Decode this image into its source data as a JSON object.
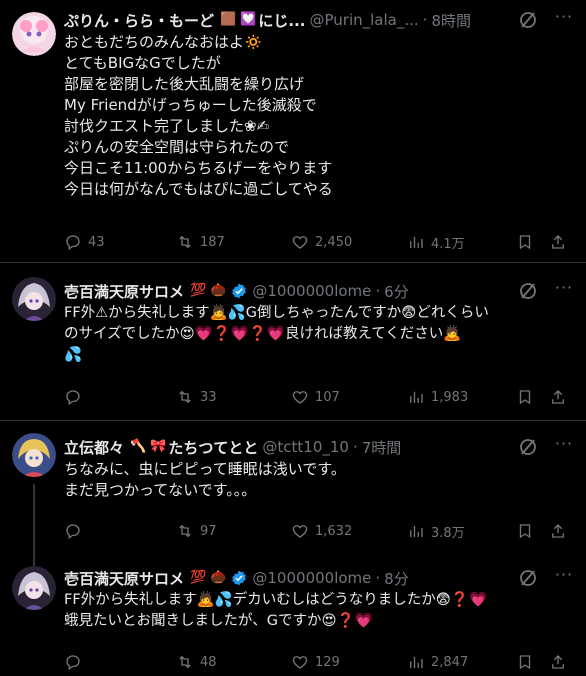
{
  "tweets": [
    {
      "name": "ぷりん・らら・もーど",
      "name_emoji": [
        "🟫",
        "💟"
      ],
      "name_suffix": "にじ...",
      "handle": "@Purin_lala_...",
      "time": "8時間",
      "lines": [
        "おともだちのみんなおはよ🔅",
        "とてもBIGなGでしたが",
        "部屋を密閉した後大乱闘を繰り広げ",
        "My Friendがげっちゅーした後滅殺で",
        "討伐クエスト完了しました❀✍",
        "ぷりんの安全空間は守られたので",
        "今日こそ11:00からちるげーをやります",
        "今日は何がなんでもはぴに過ごしてやる"
      ],
      "stats": {
        "replies": "43",
        "reposts": "187",
        "likes": "2,450",
        "views": "4.1万"
      }
    },
    {
      "name": "壱百満天原サロメ",
      "name_emoji": [
        "💯",
        "🌰"
      ],
      "handle": "@1000000lome",
      "time": "6分",
      "lines": [
        "FF外⚠から失礼します🙇💦G倒しちゃったんですか😨どれくらい",
        "のサイズでしたか😍💗❓💗❓💗良ければ教えてください🙇",
        "💦"
      ],
      "stats": {
        "replies": "",
        "reposts": "33",
        "likes": "107",
        "views": "1,983"
      }
    },
    {
      "name": "立伝都々",
      "name_emoji": [
        "🪓",
        "🎀"
      ],
      "name_suffix": "たちつてとと",
      "handle": "@tctt10_10",
      "time": "7時間",
      "lines": [
        "ちなみに、虫にピピって睡眠は浅いです。",
        "まだ見つかってないです。。。"
      ],
      "stats": {
        "replies": "",
        "reposts": "97",
        "likes": "1,632",
        "views": "3.8万"
      }
    },
    {
      "name": "壱百満天原サロメ",
      "name_emoji": [
        "💯",
        "🌰"
      ],
      "handle": "@1000000lome",
      "time": "8分",
      "lines": [
        "FF外から失礼します🙇💦デカいむしはどうなりましたか😨❓💗",
        "蛾見たいとお聞きしましたが、Gですか😍❓💗"
      ],
      "stats": {
        "replies": "",
        "reposts": "48",
        "likes": "129",
        "views": "2,847"
      }
    }
  ],
  "colors": {
    "background": "#000000",
    "text": "#e7e9ea",
    "muted": "#71767b",
    "divider": "#2f3336",
    "verified": "#1d9bf0"
  }
}
